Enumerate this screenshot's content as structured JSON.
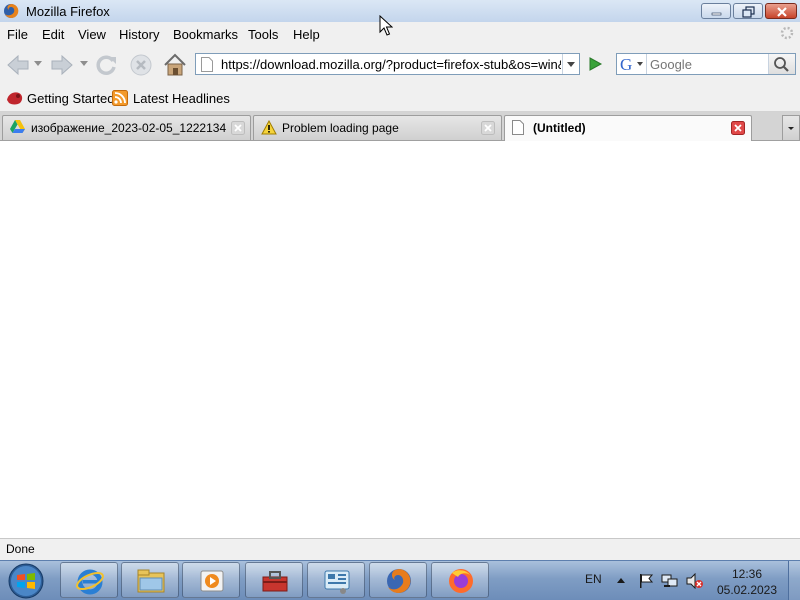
{
  "window": {
    "title": "Mozilla Firefox"
  },
  "menu": {
    "items": [
      {
        "label": "File"
      },
      {
        "label": "Edit"
      },
      {
        "label": "View"
      },
      {
        "label": "History"
      },
      {
        "label": "Bookmarks"
      },
      {
        "label": "Tools"
      },
      {
        "label": "Help"
      }
    ]
  },
  "navigation": {
    "url": "https://download.mozilla.org/?product=firefox-stub&os=win&l",
    "search_placeholder": "Google"
  },
  "bookmarks": {
    "items": [
      {
        "label": "Getting Started",
        "icon": "firefox-bookmark-icon"
      },
      {
        "label": "Latest Headlines",
        "icon": "rss-feed-icon"
      }
    ]
  },
  "tabs": [
    {
      "label": "изображение_2023-02-05_1222134...",
      "icon": "google-drive-icon",
      "active": false
    },
    {
      "label": "Problem loading page",
      "icon": "warning-icon",
      "active": false
    },
    {
      "label": "(Untitled)",
      "icon": "page-icon",
      "active": true
    }
  ],
  "status": {
    "text": "Done"
  },
  "taskbar": {
    "language": "EN",
    "time": "12:36",
    "date": "05.02.2023",
    "apps": [
      {
        "name": "internet-explorer-icon"
      },
      {
        "name": "windows-explorer-icon"
      },
      {
        "name": "media-player-icon"
      },
      {
        "name": "toolbox-icon"
      },
      {
        "name": "control-panel-icon"
      },
      {
        "name": "firefox-old-icon"
      },
      {
        "name": "firefox-new-icon"
      }
    ]
  },
  "colors": {
    "titlebar": "#c3d5ec",
    "chrome": "#f0f0f0",
    "taskbar": "#7f9dc4",
    "close_button": "#c7442a"
  }
}
